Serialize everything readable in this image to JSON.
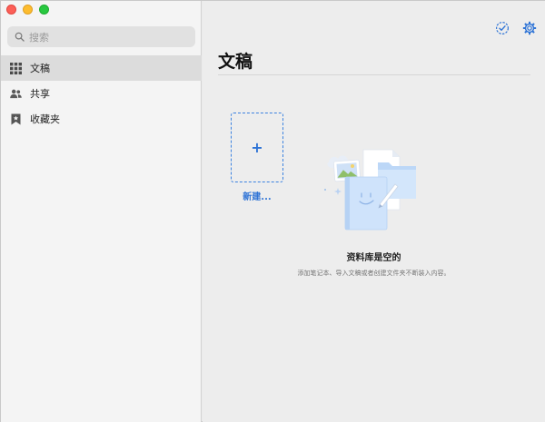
{
  "sidebar": {
    "search": {
      "placeholder": "搜索"
    },
    "items": [
      {
        "label": "文稿",
        "icon": "grid-icon",
        "active": true
      },
      {
        "label": "共享",
        "icon": "people-icon",
        "active": false
      },
      {
        "label": "收藏夹",
        "icon": "bookmark-icon",
        "active": false
      }
    ]
  },
  "main": {
    "title": "文稿",
    "new_label": "新建...",
    "new_plus": "+",
    "empty_title": "资料库是空的",
    "empty_subtitle": "添加笔记本、导入文稿或者创建文件夹不断装入内容。"
  },
  "colors": {
    "accent": "#2f74d6",
    "sidebar_bg": "#f4f4f4",
    "main_bg": "#ededed",
    "active_item_bg": "#dcdcdc"
  }
}
